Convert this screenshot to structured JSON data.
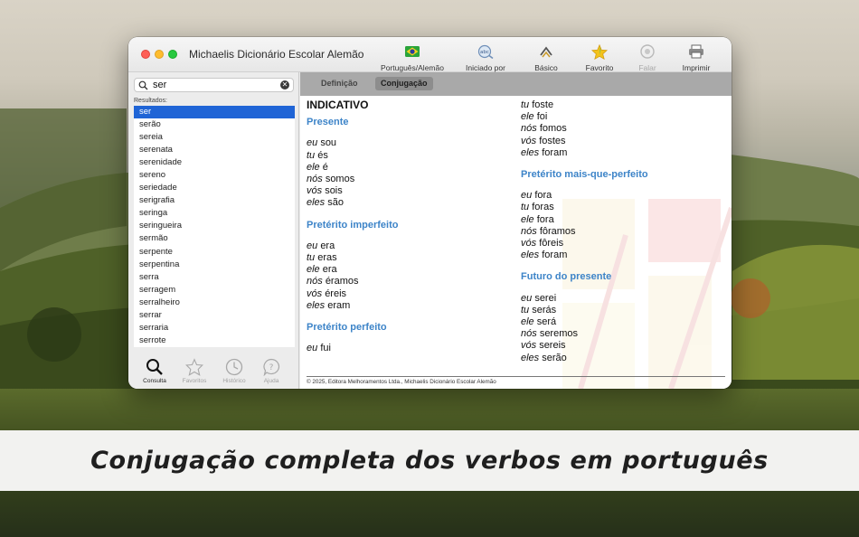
{
  "window": {
    "title": "Michaelis Dicionário Escolar Alemão"
  },
  "toolbar": [
    {
      "label": "Português/Alemão",
      "icon": "brazil-flag-icon"
    },
    {
      "label": "Iniciado por",
      "icon": "abc-search-icon"
    },
    {
      "label": "Básico",
      "icon": "chevron-up-icon"
    },
    {
      "label": "Favorito",
      "icon": "star-icon"
    },
    {
      "label": "Falar",
      "icon": "speaker-icon",
      "disabled": true
    },
    {
      "label": "Imprimir",
      "icon": "printer-icon"
    }
  ],
  "search": {
    "query": "ser",
    "results_label": "Resultados:"
  },
  "results": [
    "ser",
    "serão",
    "sereia",
    "serenata",
    "serenidade",
    "sereno",
    "seriedade",
    "serigrafia",
    "seringa",
    "seringueira",
    "sermão",
    "serpente",
    "serpentina",
    "serra",
    "serragem",
    "serralheiro",
    "serrar",
    "serraria",
    "serrote"
  ],
  "selected_result": "ser",
  "bottom_tabs": [
    {
      "label": "Consulta",
      "icon": "magnifier-icon",
      "active": true
    },
    {
      "label": "Favoritos",
      "icon": "star-outline-icon"
    },
    {
      "label": "Histórico",
      "icon": "clock-icon"
    },
    {
      "label": "Ajuda",
      "icon": "help-bubble-icon"
    }
  ],
  "segments": {
    "definicao": "Definição",
    "conjugacao": "Conjugação",
    "active": "Conjugação"
  },
  "conjugation": {
    "mood": "INDICATIVO",
    "column1": [
      {
        "tense": "Presente",
        "rows": [
          [
            "eu",
            "sou"
          ],
          [
            "tu",
            "és"
          ],
          [
            "ele",
            "é"
          ],
          [
            "nós",
            "somos"
          ],
          [
            "vós",
            "sois"
          ],
          [
            "eles",
            "são"
          ]
        ]
      },
      {
        "tense": "Pretérito imperfeito",
        "rows": [
          [
            "eu",
            "era"
          ],
          [
            "tu",
            "eras"
          ],
          [
            "ele",
            "era"
          ],
          [
            "nós",
            "éramos"
          ],
          [
            "vós",
            "éreis"
          ],
          [
            "eles",
            "eram"
          ]
        ]
      },
      {
        "tense": "Pretérito perfeito",
        "rows": [
          [
            "eu",
            "fui"
          ]
        ]
      }
    ],
    "column2_continuation": [
      [
        "tu",
        "foste"
      ],
      [
        "ele",
        "foi"
      ],
      [
        "nós",
        "fomos"
      ],
      [
        "vós",
        "fostes"
      ],
      [
        "eles",
        "foram"
      ]
    ],
    "column2": [
      {
        "tense": "Pretérito mais-que-perfeito",
        "rows": [
          [
            "eu",
            "fora"
          ],
          [
            "tu",
            "foras"
          ],
          [
            "ele",
            "fora"
          ],
          [
            "nós",
            "fôramos"
          ],
          [
            "vós",
            "fôreis"
          ],
          [
            "eles",
            "foram"
          ]
        ]
      },
      {
        "tense": "Futuro do presente",
        "rows": [
          [
            "eu",
            "serei"
          ],
          [
            "tu",
            "serás"
          ],
          [
            "ele",
            "será"
          ],
          [
            "nós",
            "seremos"
          ],
          [
            "vós",
            "sereis"
          ],
          [
            "eles",
            "serão"
          ]
        ]
      }
    ]
  },
  "footer": "© 2025, Editora Melhoramentos Ltda., Michaelis Dicionário Escolar Alemão",
  "caption": "Conjugação completa dos verbos em português",
  "colors": {
    "selection": "#1f64d6",
    "tense_heading": "#3d84c8",
    "segment_bar": "#a9a9a9"
  }
}
